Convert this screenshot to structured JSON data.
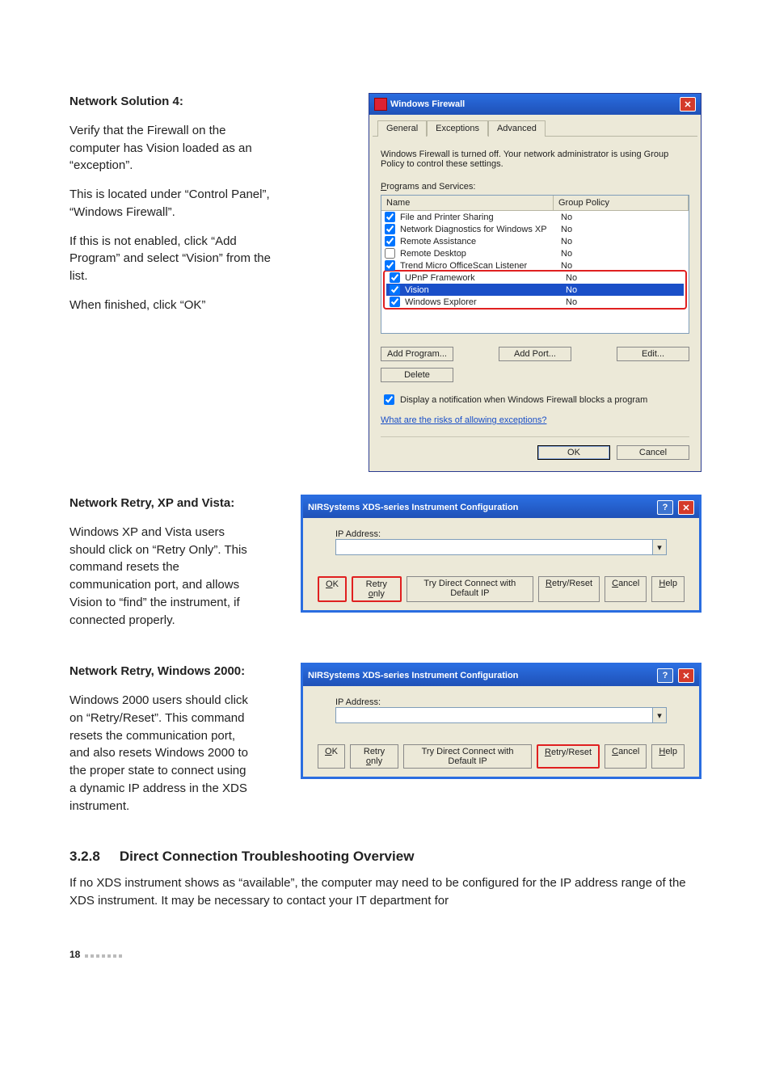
{
  "doc": {
    "solution4_heading": "Network Solution 4:",
    "solution4_p1": "Verify that the Firewall on the computer has Vision loaded as an “exception”.",
    "solution4_p2": "This is located under “Control Panel”, “Windows Firewall”.",
    "solution4_p3": "If this is not enabled, click “Add Program” and select “Vision” from the list.",
    "solution4_p4": "When finished, click “OK”",
    "retry_xp_heading": "Network Retry, XP and Vista:",
    "retry_xp_p": "Windows XP and Vista users should click on “Retry Only”. This command resets the communication port, and allows Vision to “find” the instrument, if connected properly.",
    "retry_2000_heading": "Network Retry, Windows 2000:",
    "retry_2000_p": "Windows 2000 users should click on “Retry/Reset”. This command resets the communication port, and also resets Windows 2000 to the proper state to connect using a dynamic IP address in the XDS instrument.",
    "section_num": "3.2.8",
    "section_title": "Direct Connection Troubleshooting Overview",
    "section_body": "If no XDS instrument shows as “available”, the computer may need to be configured for the IP address range of the XDS instrument. It may be necessary to contact your IT department for",
    "page_number": "18"
  },
  "firewall": {
    "title": "Windows Firewall",
    "tabs": {
      "general": "General",
      "exceptions": "Exceptions",
      "advanced": "Advanced"
    },
    "message": "Windows Firewall is turned off. Your network administrator is using Group Policy to control these settings.",
    "programs_label": "Programs and Services:",
    "columns": {
      "name": "Name",
      "gp": "Group Policy"
    },
    "rows": [
      {
        "checked": true,
        "name": "File and Printer Sharing",
        "gp": "No"
      },
      {
        "checked": true,
        "name": "Network Diagnostics for Windows XP",
        "gp": "No"
      },
      {
        "checked": true,
        "name": "Remote Assistance",
        "gp": "No"
      },
      {
        "checked": false,
        "name": "Remote Desktop",
        "gp": "No"
      },
      {
        "checked": true,
        "name": "Trend Micro OfficeScan Listener",
        "gp": "No"
      },
      {
        "checked": true,
        "name": "UPnP Framework",
        "gp": "No"
      },
      {
        "checked": true,
        "name": "Vision",
        "gp": "No"
      },
      {
        "checked": true,
        "name": "Windows Explorer",
        "gp": "No"
      }
    ],
    "buttons": {
      "add_program": "Add Program...",
      "add_port": "Add Port...",
      "edit": "Edit...",
      "delete": "Delete"
    },
    "notify_label": "Display a notification when Windows Firewall blocks a program",
    "risks_link": "What are the risks of allowing exceptions?",
    "ok": "OK",
    "cancel": "Cancel"
  },
  "nir": {
    "title": "NIRSystems XDS-series Instrument Configuration",
    "ip_label": "IP Address:",
    "buttons": {
      "ok": "OK",
      "retry_only": "Retry only",
      "try_direct": "Try Direct Connect with Default IP",
      "retry_reset": "Retry/Reset",
      "cancel": "Cancel",
      "help": "Help"
    },
    "help_glyph": "?",
    "close_glyph": "✕",
    "arrow_glyph": "▾"
  }
}
